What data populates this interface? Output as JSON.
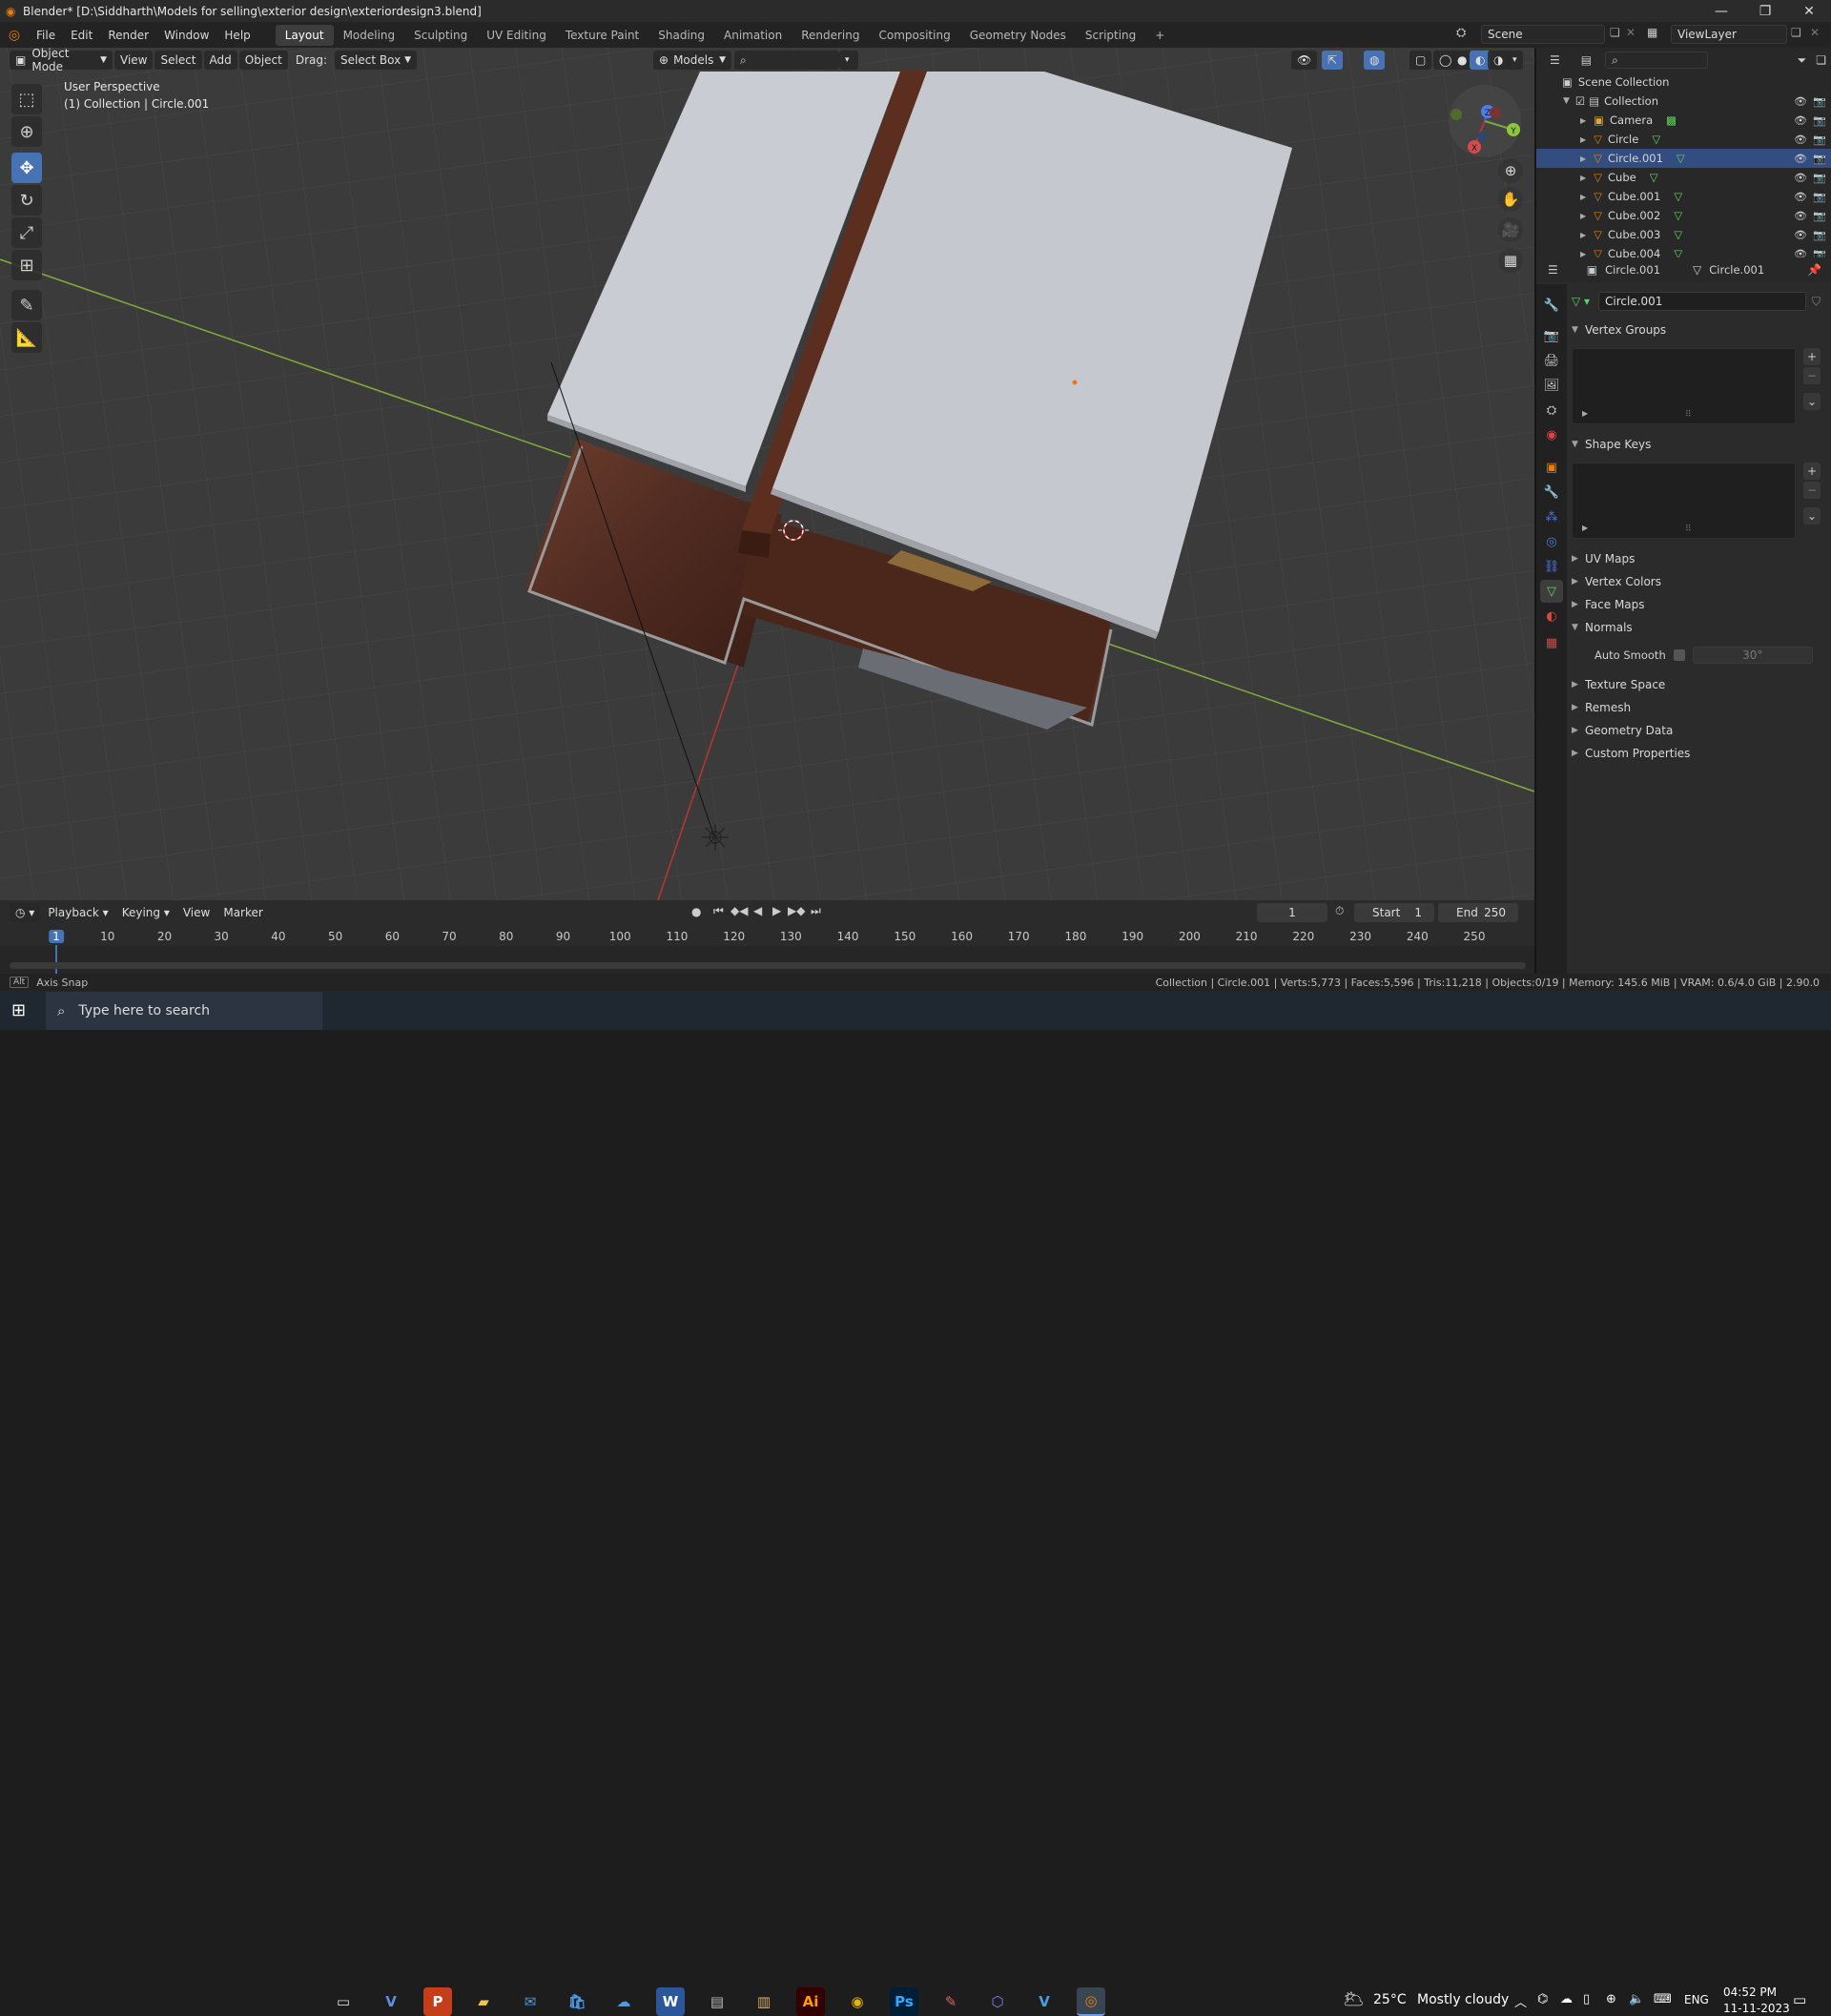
{
  "window": {
    "title": "Blender* [D:\\Siddharth\\Models for selling\\exterior design\\exteriordesign3.blend]",
    "minimize": "—",
    "maximize": "❐",
    "close": "✕"
  },
  "menus": [
    "File",
    "Edit",
    "Render",
    "Window",
    "Help"
  ],
  "workspaces": [
    "Layout",
    "Modeling",
    "Sculpting",
    "UV Editing",
    "Texture Paint",
    "Shading",
    "Animation",
    "Rendering",
    "Compositing",
    "Geometry Nodes",
    "Scripting"
  ],
  "active_workspace": "Layout",
  "add_workspace": "+",
  "scene": {
    "name": "Scene",
    "view_layer": "ViewLayer"
  },
  "viewport_header": {
    "mode": "Object Mode",
    "view": "View",
    "select": "Select",
    "add": "Add",
    "object": "Object",
    "drag_label": "Drag:",
    "drag_value": "Select Box",
    "transform_orientation": "Models"
  },
  "viewport_overlay": {
    "perspective": "User Perspective",
    "collection_info": "(1) Collection | Circle.001"
  },
  "gizmo": {
    "x": "X",
    "y": "Y",
    "z": "Z"
  },
  "outliner": {
    "root": "Scene Collection",
    "collection": "Collection",
    "items": [
      {
        "name": "Camera",
        "type": "camera"
      },
      {
        "name": "Circle",
        "type": "mesh"
      },
      {
        "name": "Circle.001",
        "type": "mesh"
      },
      {
        "name": "Cube",
        "type": "mesh"
      },
      {
        "name": "Cube.001",
        "type": "mesh"
      },
      {
        "name": "Cube.002",
        "type": "mesh"
      },
      {
        "name": "Cube.003",
        "type": "mesh"
      },
      {
        "name": "Cube.004",
        "type": "mesh"
      }
    ]
  },
  "properties": {
    "object_name": "Circle.001",
    "data_name": "Circle.001",
    "mesh_name": "Circle.001",
    "sections": {
      "vertex_groups": "Vertex Groups",
      "shape_keys": "Shape Keys",
      "uv_maps": "UV Maps",
      "vertex_colors": "Vertex Colors",
      "face_maps": "Face Maps",
      "normals": "Normals",
      "auto_smooth": "Auto Smooth",
      "auto_smooth_angle": "30°",
      "texture_space": "Texture Space",
      "remesh": "Remesh",
      "geometry_data": "Geometry Data",
      "custom_properties": "Custom Properties"
    }
  },
  "timeline": {
    "playback": "Playback",
    "keying": "Keying",
    "view": "View",
    "marker": "Marker",
    "current_frame": "1",
    "start_label": "Start",
    "start": "1",
    "end_label": "End",
    "end": "250",
    "ruler": [
      "1",
      "10",
      "20",
      "30",
      "40",
      "50",
      "60",
      "70",
      "80",
      "90",
      "100",
      "110",
      "120",
      "130",
      "140",
      "150",
      "160",
      "170",
      "180",
      "190",
      "200",
      "210",
      "220",
      "230",
      "240",
      "250"
    ]
  },
  "statusbar": {
    "left": "Axis Snap",
    "right": "Collection | Circle.001 | Verts:5,773 | Faces:5,596 | Tris:11,218 | Objects:0/19 | Memory: 145.6 MiB | VRAM: 0.6/4.0 GiB | 2.90.0"
  },
  "taskbar": {
    "search_placeholder": "Type here to search",
    "weather_temp": "25°C",
    "weather_desc": "Mostly cloudy",
    "language": "ENG",
    "time": "04:52 PM",
    "date": "11-11-2023"
  },
  "colors": {
    "accent": "#4772b3",
    "active_object": "#e87d0d",
    "x_axis": "#b53535",
    "y_axis": "#7ea83a",
    "z_axis": "#3c6fd1"
  }
}
